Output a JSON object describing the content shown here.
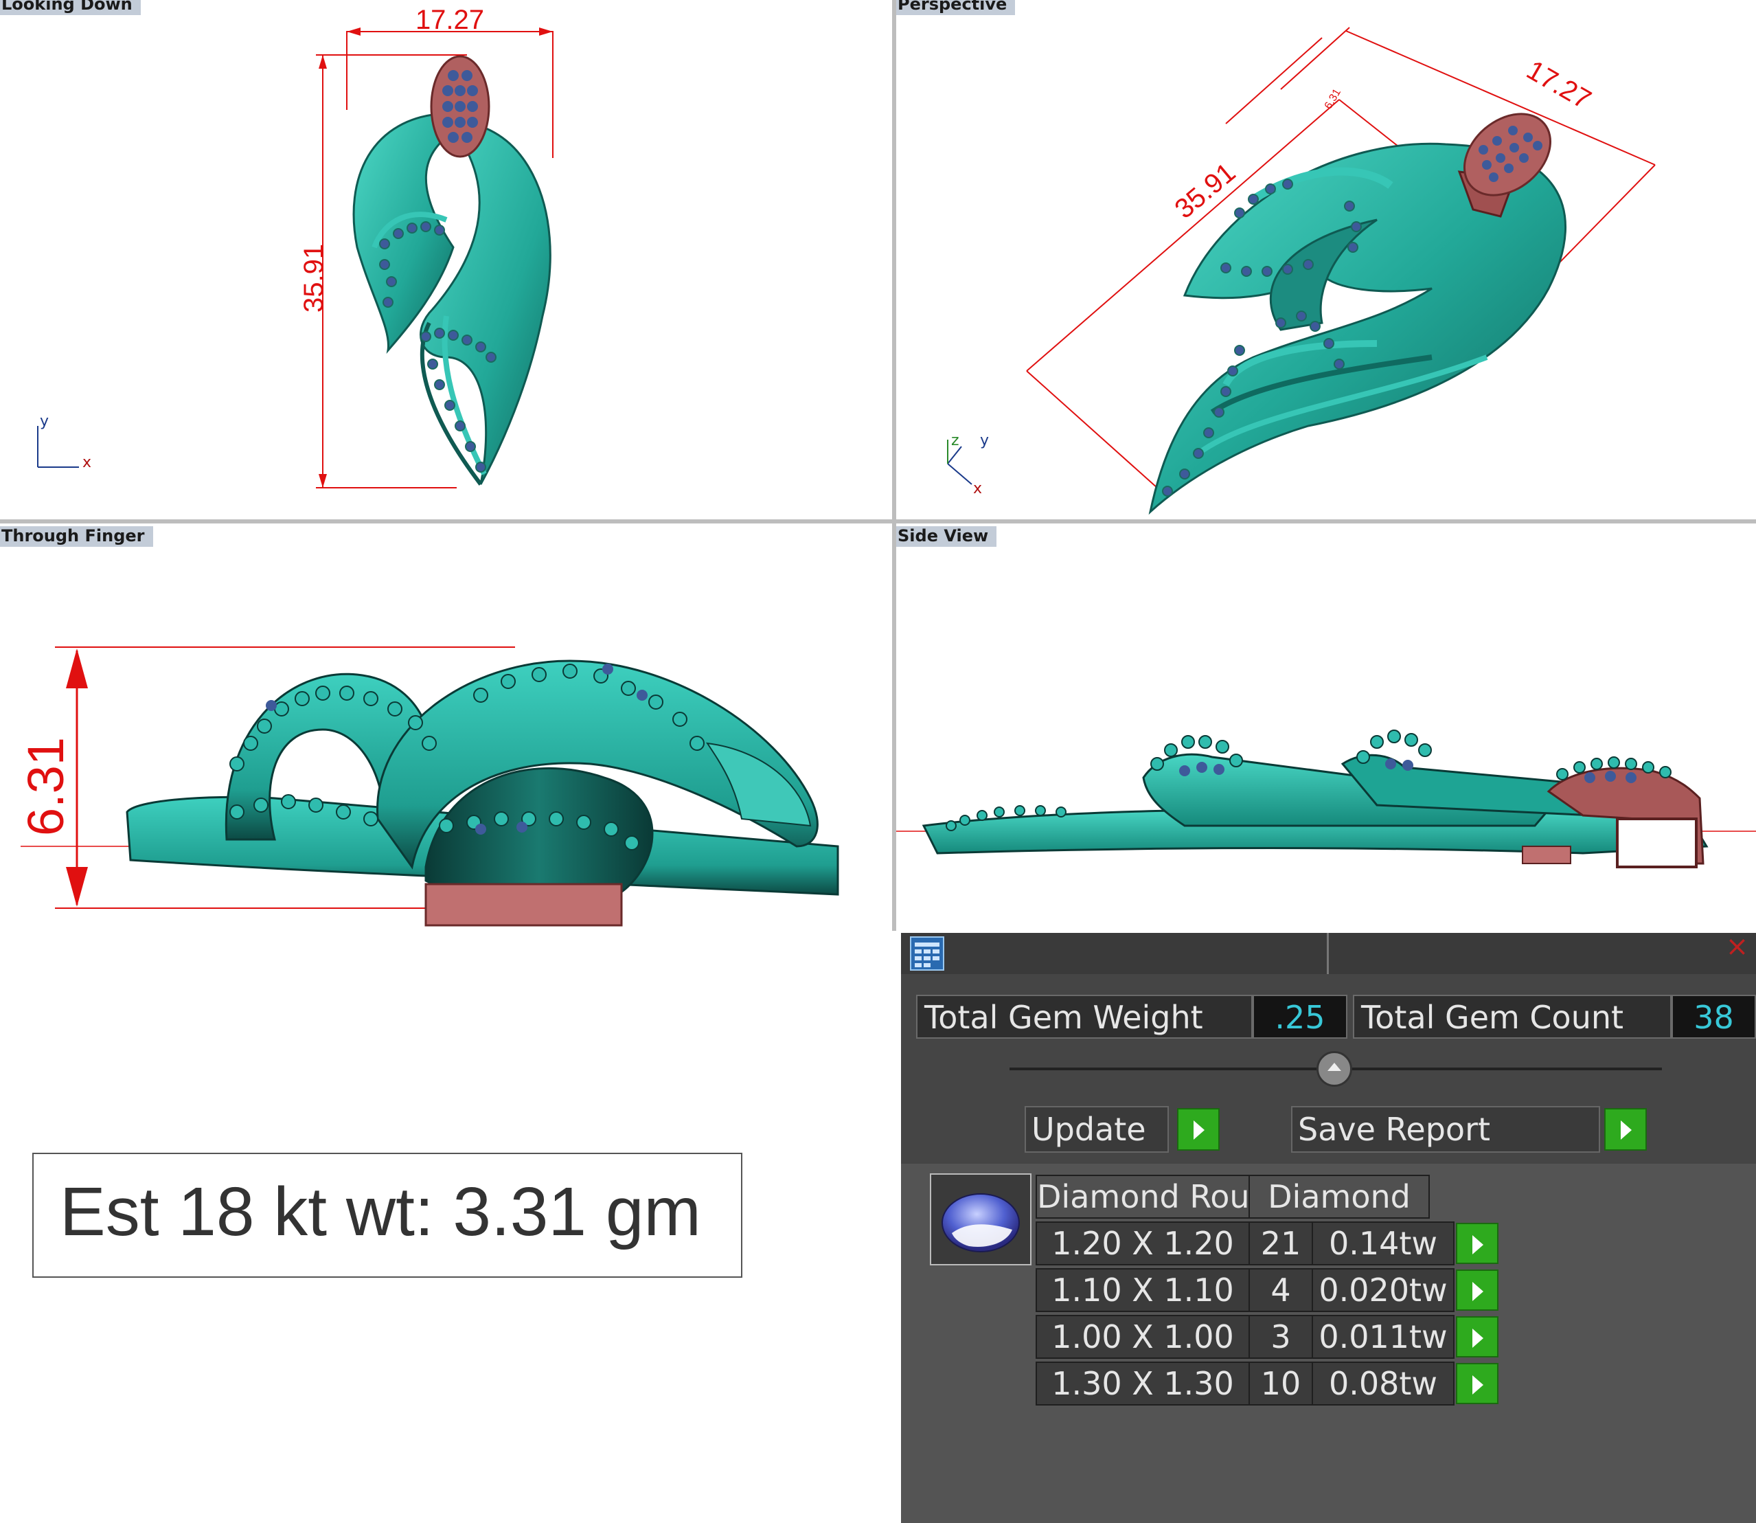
{
  "viewports": {
    "top_left": {
      "label": "Looking Down",
      "dim_width": "17.27",
      "dim_height": "35.91",
      "axis_x": "x",
      "axis_y": "y"
    },
    "top_right": {
      "label": "Perspective",
      "dim_width": "17.27",
      "dim_length": "35.91",
      "dim_small": "6.31",
      "axis_x": "x",
      "axis_y": "y",
      "axis_z": "z"
    },
    "bottom_left": {
      "label": "Through Finger",
      "dim_height": "6.31"
    },
    "bottom_right": {
      "label": "Side View"
    }
  },
  "metal_weight": "Est 18 kt wt: 3.31 gm",
  "gem_report": {
    "total_weight_label": "Total Gem Weight",
    "total_weight_value": ".25",
    "total_count_label": "Total Gem Count",
    "total_count_value": "38",
    "update_label": "Update",
    "save_label": "Save Report",
    "close_symbol": "×",
    "table": {
      "headers": [
        "Diamond Round",
        "Diamond"
      ],
      "rows": [
        {
          "size": "1.20 X 1.20",
          "count": "21",
          "weight": "0.14tw"
        },
        {
          "size": "1.10 X 1.10",
          "count": "4",
          "weight": "0.020tw"
        },
        {
          "size": "1.00 X 1.00",
          "count": "3",
          "weight": "0.011tw"
        },
        {
          "size": "1.30 X 1.30",
          "count": "10",
          "weight": "0.08tw"
        }
      ]
    }
  },
  "colors": {
    "metal": "#2fb8a8",
    "bail": "#b06060",
    "gem": "#4a5ab0",
    "dimension": "#e01010",
    "accent_value": "#38c8d8",
    "play_button": "#2eaa1e"
  }
}
